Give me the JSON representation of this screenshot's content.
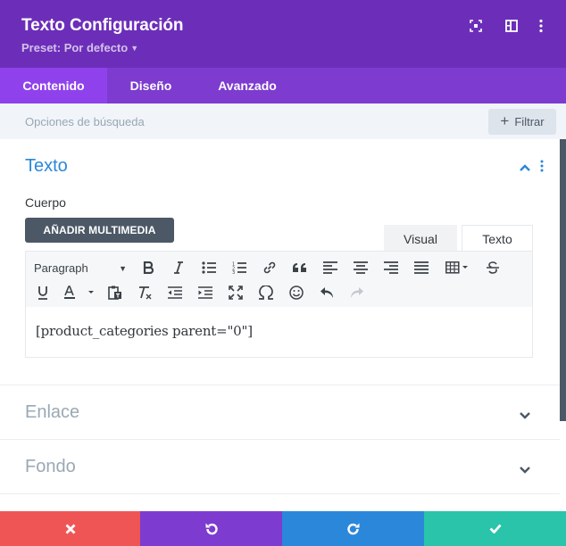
{
  "header": {
    "title": "Texto Configuración",
    "preset_label": "Preset: Por defecto",
    "icons": [
      "fullscreen-icon",
      "split-view-icon",
      "more-options-icon"
    ],
    "color": "#6c2eb9"
  },
  "tabs": [
    {
      "label": "Contenido",
      "active": true
    },
    {
      "label": "Diseño",
      "active": false
    },
    {
      "label": "Avanzado",
      "active": false
    }
  ],
  "search": {
    "placeholder": "Opciones de búsqueda",
    "filter_label": "Filtrar"
  },
  "sections": {
    "texto": {
      "title": "Texto",
      "body_label": "Cuerpo",
      "add_media_label": "AÑADIR MULTIMEDIA",
      "mode_tabs": [
        "Visual",
        "Texto"
      ],
      "format_value": "Paragraph",
      "content": "[product_categories parent=\"0\"]"
    },
    "enlace": {
      "title": "Enlace"
    },
    "fondo": {
      "title": "Fondo"
    }
  },
  "toolbar_icons": {
    "row1": [
      "bold-icon",
      "italic-icon",
      "bullet-list-icon",
      "numbered-list-icon",
      "link-icon",
      "blockquote-icon",
      "align-left-icon",
      "align-center-icon",
      "align-right-icon",
      "justify-icon",
      "table-icon",
      "strikethrough-icon"
    ],
    "row2": [
      "underline-icon",
      "text-color-icon",
      "paste-text-icon",
      "clear-formatting-icon",
      "outdent-icon",
      "indent-icon",
      "fullscreen-editor-icon",
      "special-character-icon",
      "emoji-icon",
      "undo-icon",
      "redo-icon"
    ]
  },
  "footer": {
    "buttons": [
      {
        "icon": "close-icon",
        "color": "#ef5555"
      },
      {
        "icon": "undo-icon",
        "color": "#7e3bd0"
      },
      {
        "icon": "redo-icon",
        "color": "#2b87da"
      },
      {
        "icon": "checkmark-icon",
        "color": "#29c4a9"
      }
    ]
  }
}
